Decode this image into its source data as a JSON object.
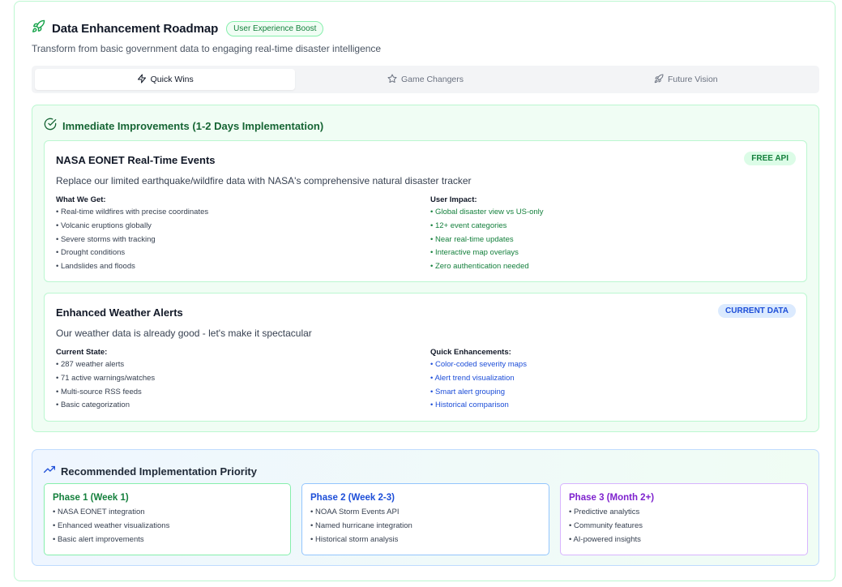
{
  "header": {
    "title": "Data Enhancement Roadmap",
    "badge": "User Experience Boost",
    "subtitle": "Transform from basic government data to engaging real-time disaster intelligence",
    "icon": "rocket-icon"
  },
  "tabs": [
    {
      "label": "Quick Wins",
      "icon": "lightning-icon",
      "active": true
    },
    {
      "label": "Game Changers",
      "icon": "star-icon",
      "active": false
    },
    {
      "label": "Future Vision",
      "icon": "rocket-icon",
      "active": false
    }
  ],
  "section": {
    "title": "Immediate Improvements (1-2 Days Implementation)",
    "icon": "check-circle-icon"
  },
  "cards": [
    {
      "title": "NASA EONET Real-Time Events",
      "badge": "FREE API",
      "description": "Replace our limited earthquake/wildfire data with NASA's comprehensive natural disaster tracker",
      "left_head": "What We Get:",
      "left_items": [
        "Real-time wildfires with precise coordinates",
        "Volcanic eruptions globally",
        "Severe storms with tracking",
        "Drought conditions",
        "Landslides and floods"
      ],
      "right_head": "User Impact:",
      "right_items": [
        "Global disaster view vs US-only",
        "12+ event categories",
        "Near real-time updates",
        "Interactive map overlays",
        "Zero authentication needed"
      ]
    },
    {
      "title": "Enhanced Weather Alerts",
      "badge": "CURRENT DATA",
      "description": "Our weather data is already good - let's make it spectacular",
      "left_head": "Current State:",
      "left_items": [
        "287 weather alerts",
        "71 active warnings/watches",
        "Multi-source RSS feeds",
        "Basic categorization"
      ],
      "right_head": "Quick Enhancements:",
      "right_items": [
        "Color-coded severity maps",
        "Alert trend visualization",
        "Smart alert grouping",
        "Historical comparison"
      ]
    }
  ],
  "priority": {
    "title": "Recommended Implementation Priority",
    "icon": "trending-up-icon",
    "phases": [
      {
        "title": "Phase 1 (Week 1)",
        "items": [
          "NASA EONET integration",
          "Enhanced weather visualizations",
          "Basic alert improvements"
        ]
      },
      {
        "title": "Phase 2 (Week 2-3)",
        "items": [
          "NOAA Storm Events API",
          "Named hurricane integration",
          "Historical storm analysis"
        ]
      },
      {
        "title": "Phase 3 (Month 2+)",
        "items": [
          "Predictive analytics",
          "Community features",
          "AI-powered insights"
        ]
      }
    ]
  },
  "colors": {
    "green": "#15803d",
    "blue": "#1d4ed8",
    "purple": "#7e22ce"
  }
}
